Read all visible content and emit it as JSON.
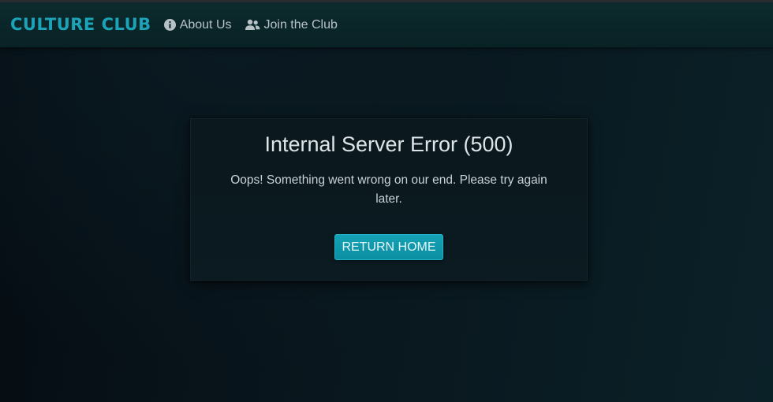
{
  "navbar": {
    "brand": "CULTURE CLUB",
    "brand_color": "#1ba3b8",
    "links": [
      {
        "label": "About Us",
        "icon": "info-circle-icon"
      },
      {
        "label": "Join the Club",
        "icon": "users-icon"
      }
    ]
  },
  "error": {
    "title": "Internal Server Error (500)",
    "message": "Oops! Something went wrong on our end. Please try again later.",
    "button_label": "Return Home",
    "button_color": "#0f97ab"
  }
}
